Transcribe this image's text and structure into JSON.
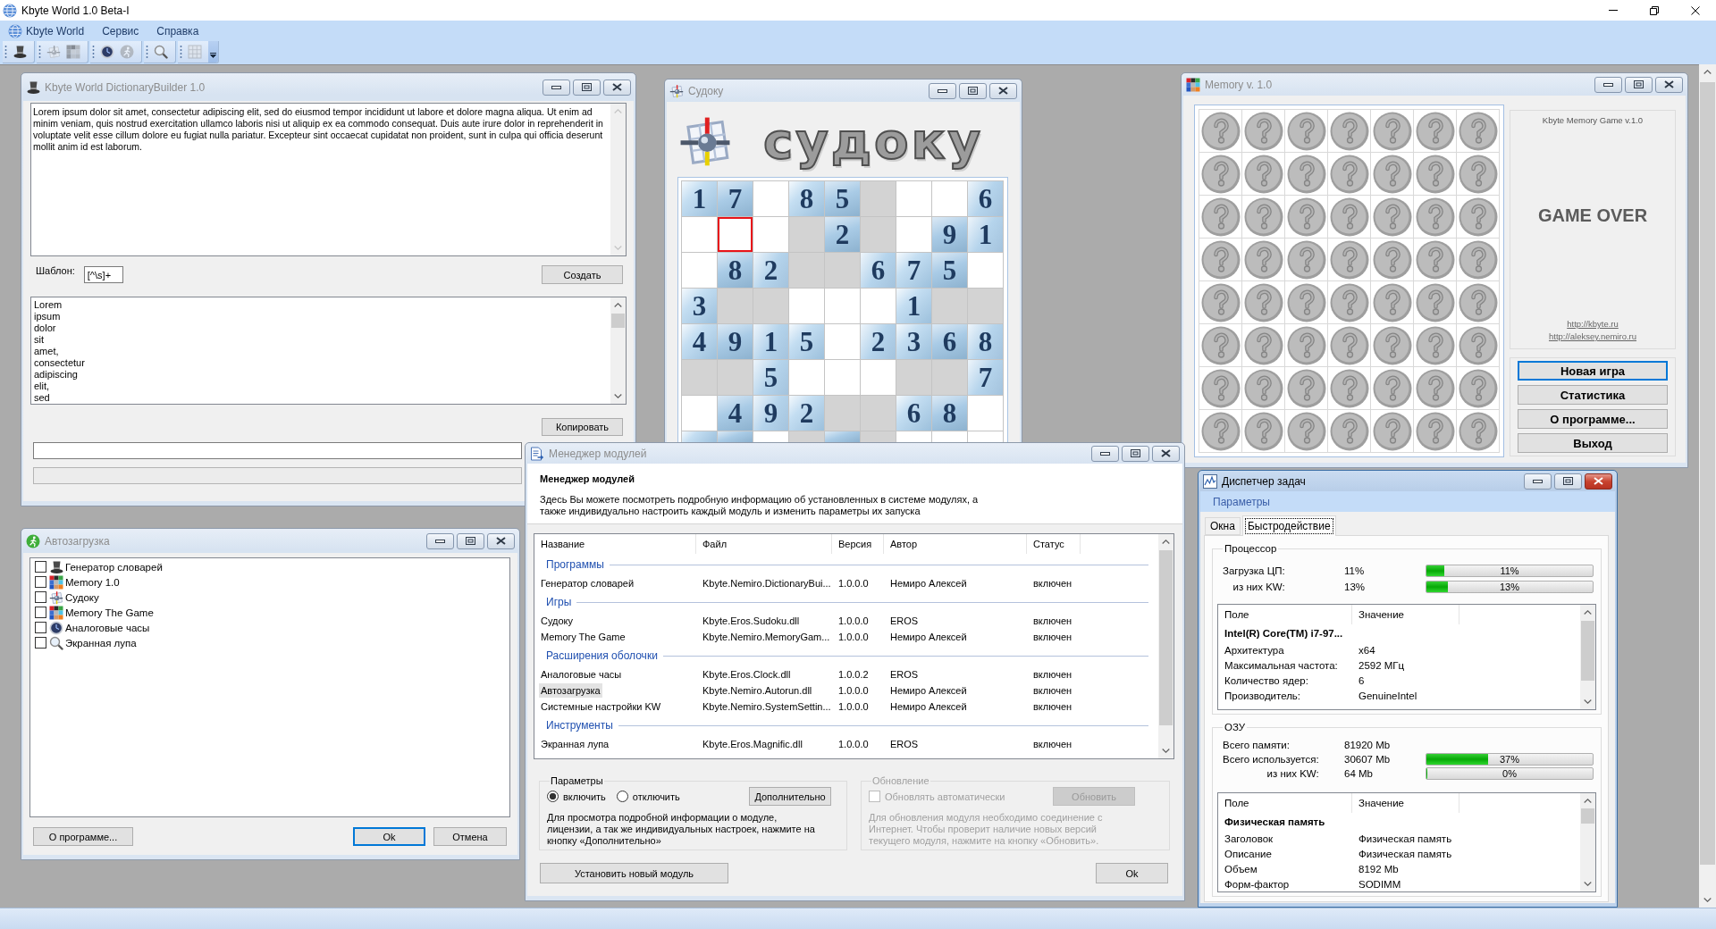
{
  "app": {
    "title": "Kbyte World 1.0 Beta-I",
    "menu": [
      {
        "label": "Kbyte World"
      },
      {
        "label": "Сервис"
      },
      {
        "label": "Справка"
      }
    ]
  },
  "toolbar": [
    {
      "disabled": false
    },
    {
      "disabled": true
    },
    {
      "disabled": true
    },
    {
      "disabled": false
    },
    {
      "disabled": true
    },
    {
      "disabled": false
    },
    {
      "disabled": true
    }
  ],
  "dictionary": {
    "title": "Kbyte World DictionaryBuilder 1.0",
    "active": false,
    "text": "Lorem ipsum dolor sit amet, consectetur adipiscing elit, sed do eiusmod tempor incididunt ut labore et dolore magna aliqua. Ut enim ad minim veniam, quis nostrud exercitation ullamco laboris nisi ut aliquip ex ea commodo consequat. Duis aute irure dolor in reprehenderit in voluptate velit esse cillum dolore eu fugiat nulla pariatur. Excepteur sint occaecat cupidatat non proident, sunt in culpa qui officia deserunt mollit anim id est laborum.",
    "pattern_label": "Шаблон:",
    "pattern_value": "[^\\s]+",
    "create_button": "Создать",
    "words": [
      {
        "label": "Lorem",
        "selected": false
      },
      {
        "label": "ipsum",
        "selected": false
      },
      {
        "label": "dolor",
        "selected": false
      },
      {
        "label": "sit",
        "selected": false
      },
      {
        "label": "amet,",
        "selected": false
      },
      {
        "label": "consectetur",
        "selected": false
      },
      {
        "label": "adipiscing",
        "selected": false
      },
      {
        "label": "elit,",
        "selected": false
      },
      {
        "label": "sed",
        "selected": false
      }
    ],
    "copy_button": "Копировать",
    "status_field": {
      "disabled": true
    }
  },
  "sudoku": {
    "title": "Судоку",
    "active": false,
    "logo_text": "судоку",
    "rows": [
      [
        {
          "filled": true,
          "digit": "1",
          "selected": false
        },
        {
          "filled": true,
          "digit": "7",
          "selected": false
        },
        {
          "filled": false,
          "selected": false
        },
        {
          "filled": true,
          "digit": "8",
          "selected": false
        },
        {
          "filled": true,
          "digit": "5",
          "selected": false
        },
        {
          "filled": false,
          "selected": false
        },
        {
          "filled": false,
          "selected": false
        },
        {
          "filled": false,
          "selected": false
        },
        {
          "filled": true,
          "digit": "6",
          "selected": false
        }
      ],
      [
        {
          "filled": false,
          "selected": false
        },
        {
          "filled": false,
          "selected": true
        },
        {
          "filled": false,
          "selected": false
        },
        {
          "filled": false,
          "selected": false
        },
        {
          "filled": true,
          "digit": "2",
          "selected": false
        },
        {
          "filled": false,
          "selected": false
        },
        {
          "filled": false,
          "selected": false
        },
        {
          "filled": true,
          "digit": "9",
          "selected": false
        },
        {
          "filled": true,
          "digit": "1",
          "selected": false
        }
      ],
      [
        {
          "filled": false,
          "selected": false
        },
        {
          "filled": true,
          "digit": "8",
          "selected": false
        },
        {
          "filled": true,
          "digit": "2",
          "selected": false
        },
        {
          "filled": false,
          "selected": false
        },
        {
          "filled": false,
          "selected": false
        },
        {
          "filled": true,
          "digit": "6",
          "selected": false
        },
        {
          "filled": true,
          "digit": "7",
          "selected": false
        },
        {
          "filled": true,
          "digit": "5",
          "selected": false
        },
        {
          "filled": false,
          "selected": false
        }
      ],
      [
        {
          "filled": true,
          "digit": "3",
          "selected": false
        },
        {
          "filled": false,
          "selected": false
        },
        {
          "filled": false,
          "selected": false
        },
        {
          "filled": false,
          "selected": false
        },
        {
          "filled": false,
          "selected": false
        },
        {
          "filled": false,
          "selected": false
        },
        {
          "filled": true,
          "digit": "1",
          "selected": false
        },
        {
          "filled": false,
          "selected": false
        },
        {
          "filled": false,
          "selected": false
        }
      ],
      [
        {
          "filled": true,
          "digit": "4",
          "selected": false
        },
        {
          "filled": true,
          "digit": "9",
          "selected": false
        },
        {
          "filled": true,
          "digit": "1",
          "selected": false
        },
        {
          "filled": true,
          "digit": "5",
          "selected": false
        },
        {
          "filled": false,
          "selected": false
        },
        {
          "filled": true,
          "digit": "2",
          "selected": false
        },
        {
          "filled": true,
          "digit": "3",
          "selected": false
        },
        {
          "filled": true,
          "digit": "6",
          "selected": false
        },
        {
          "filled": true,
          "digit": "8",
          "selected": false
        }
      ],
      [
        {
          "filled": false,
          "selected": false
        },
        {
          "filled": false,
          "selected": false
        },
        {
          "filled": true,
          "digit": "5",
          "selected": false
        },
        {
          "filled": false,
          "selected": false
        },
        {
          "filled": false,
          "selected": false
        },
        {
          "filled": false,
          "selected": false
        },
        {
          "filled": false,
          "selected": false
        },
        {
          "filled": false,
          "selected": false
        },
        {
          "filled": true,
          "digit": "7",
          "selected": false
        }
      ],
      [
        {
          "filled": false,
          "selected": false
        },
        {
          "filled": true,
          "digit": "4",
          "selected": false
        },
        {
          "filled": true,
          "digit": "9",
          "selected": false
        },
        {
          "filled": true,
          "digit": "2",
          "selected": false
        },
        {
          "filled": false,
          "selected": false
        },
        {
          "filled": false,
          "selected": false
        },
        {
          "filled": true,
          "digit": "6",
          "selected": false
        },
        {
          "filled": true,
          "digit": "8",
          "selected": false
        },
        {
          "filled": false,
          "selected": false
        }
      ],
      [
        {
          "filled": true,
          "selected": false
        },
        {
          "filled": true,
          "selected": false
        },
        {
          "filled": false,
          "selected": false
        },
        {
          "filled": false,
          "selected": false
        },
        {
          "filled": true,
          "selected": false
        },
        {
          "filled": false,
          "selected": false
        },
        {
          "filled": false,
          "selected": false
        },
        {
          "filled": false,
          "selected": false
        },
        {
          "filled": false,
          "selected": false
        }
      ]
    ]
  },
  "memory": {
    "title": "Memory v. 1.0",
    "active": false,
    "board": [
      [
        {
          "revealed": false
        },
        {
          "revealed": false
        },
        {
          "revealed": false
        },
        {
          "revealed": false
        },
        {
          "revealed": false
        },
        {
          "revealed": false
        },
        {
          "revealed": false
        }
      ],
      [
        {
          "revealed": false
        },
        {
          "revealed": false
        },
        {
          "revealed": false
        },
        {
          "revealed": false
        },
        {
          "revealed": false
        },
        {
          "revealed": false
        },
        {
          "revealed": false
        }
      ],
      [
        {
          "revealed": false
        },
        {
          "revealed": false
        },
        {
          "revealed": false
        },
        {
          "revealed": false
        },
        {
          "revealed": false
        },
        {
          "revealed": false
        },
        {
          "revealed": false
        }
      ],
      [
        {
          "revealed": false
        },
        {
          "revealed": false
        },
        {
          "revealed": false
        },
        {
          "revealed": false
        },
        {
          "revealed": false
        },
        {
          "revealed": false
        },
        {
          "revealed": false
        }
      ],
      [
        {
          "revealed": false
        },
        {
          "revealed": false
        },
        {
          "revealed": false
        },
        {
          "revealed": false
        },
        {
          "revealed": false
        },
        {
          "revealed": false
        },
        {
          "revealed": false
        }
      ],
      [
        {
          "revealed": false
        },
        {
          "revealed": false
        },
        {
          "revealed": false
        },
        {
          "revealed": false
        },
        {
          "revealed": false
        },
        {
          "revealed": false
        },
        {
          "revealed": false
        }
      ],
      [
        {
          "revealed": false
        },
        {
          "revealed": false
        },
        {
          "revealed": false
        },
        {
          "revealed": false
        },
        {
          "revealed": false
        },
        {
          "revealed": false
        },
        {
          "revealed": false
        }
      ],
      [
        {
          "revealed": false
        },
        {
          "revealed": false
        },
        {
          "revealed": false
        },
        {
          "revealed": false
        },
        {
          "revealed": false
        },
        {
          "revealed": false
        },
        {
          "revealed": false
        }
      ]
    ],
    "caption": "Kbyte Memory Game v.1.0",
    "status": "GAME OVER",
    "links": [
      "http://kbyte.ru",
      "http://aleksey.nemiro.ru"
    ],
    "buttons": [
      {
        "label": "Новая игра",
        "focused": true
      },
      {
        "label": "Статистика",
        "focused": false
      },
      {
        "label": "О программе...",
        "focused": false
      },
      {
        "label": "Выход",
        "focused": false
      }
    ]
  },
  "autorun": {
    "title": "Автозагрузка",
    "active": false,
    "items": [
      {
        "label": "Генератор словарей",
        "checked": false
      },
      {
        "label": "Memory 1.0",
        "checked": false
      },
      {
        "label": "Судоку",
        "checked": false
      },
      {
        "label": "Memory The Game",
        "checked": false
      },
      {
        "label": "Аналоговые часы",
        "checked": false
      },
      {
        "label": "Экранная лупа",
        "checked": false
      }
    ],
    "buttons": [
      {
        "label": "О программе...",
        "focused": false
      },
      {
        "label": "Ok",
        "focused": true
      },
      {
        "label": "Отмена",
        "focused": false
      }
    ]
  },
  "modules": {
    "title": "Менеджер модулей",
    "active": false,
    "heading": "Менеджер модулей",
    "description": "Здесь Вы можете посмотреть подробную информацию об установленных в системе модулях, а также индивидуально настроить каждый модуль и изменить параметры их запуска",
    "columns": [
      "Название",
      "Файл",
      "Версия",
      "Автор",
      "Статус"
    ],
    "groups": [
      {
        "name": "Программы",
        "rows": [
          {
            "cells": [
              "Генератор словарей",
              "Kbyte.Nemiro.DictionaryBui...",
              "1.0.0.0",
              "Немиро Алексей",
              "включен"
            ],
            "selected": false
          }
        ]
      },
      {
        "name": "Игры",
        "rows": [
          {
            "cells": [
              "Судоку",
              "Kbyte.Eros.Sudoku.dll",
              "1.0.0.0",
              "EROS",
              "включен"
            ],
            "selected": false
          },
          {
            "cells": [
              "Memory The Game",
              "Kbyte.Nemiro.MemoryGam...",
              "1.0.0.0",
              "Немиро Алексей",
              "включен"
            ],
            "selected": false
          }
        ]
      },
      {
        "name": "Расширения оболочки",
        "rows": [
          {
            "cells": [
              "Аналоговые часы",
              "Kbyte.Eros.Clock.dll",
              "1.0.0.2",
              "EROS",
              "включен"
            ],
            "selected": false
          },
          {
            "cells": [
              "Автозагрузка",
              "Kbyte.Nemiro.Autorun.dll",
              "1.0.0.0",
              "Немиро Алексей",
              "включен"
            ],
            "selected": true
          },
          {
            "cells": [
              "Системные настройки KW",
              "Kbyte.Nemiro.SystemSettin...",
              "1.0.0.0",
              "Немиро Алексей",
              "включен"
            ],
            "selected": false
          }
        ]
      },
      {
        "name": "Инструменты",
        "rows": [
          {
            "cells": [
              "Экранная лупа",
              "Kbyte.Eros.Magnific.dll",
              "1.0.0.0",
              "EROS",
              "включен"
            ],
            "selected": false
          }
        ]
      }
    ],
    "parameters": {
      "title": "Параметры",
      "options": [
        {
          "label": "включить",
          "selected": true
        },
        {
          "label": "отключить",
          "selected": false
        }
      ],
      "button": "Дополнительно",
      "note": "Для просмотра подробной информации о модуле, лицензии, а так же индивидуальных настроек, нажмите на кнопку «Дополнительно»"
    },
    "update": {
      "title": "Обновление",
      "disabled": true,
      "checkbox": {
        "label": "Обновлять автоматически",
        "checked": false
      },
      "button": "Обновить",
      "note": "Для обновления модуля необходимо соединение с Интернет. Чтобы проверит наличие новых версий текущего модуля, нажмите на кнопку «Обновить»."
    },
    "buttons": [
      {
        "label": "Установить новый модуль",
        "focused": false
      },
      {
        "label": "Ok",
        "focused": false
      }
    ]
  },
  "task_manager": {
    "title": "Диспетчер задач",
    "active": true,
    "menu": [
      {
        "label": "Параметры"
      }
    ],
    "tabs": [
      {
        "label": "Окна",
        "selected": false
      },
      {
        "label": "Быстродействие",
        "selected": true
      }
    ],
    "cpu": {
      "title": "Процессор",
      "stats": [
        {
          "kind": "main",
          "label": "Загрузка ЦП:",
          "value": "11%",
          "level": 0.11,
          "reading": "11%"
        },
        {
          "kind": "sub",
          "label": "из них KW:",
          "value": "13%",
          "level": 0.13,
          "reading": "13%"
        }
      ],
      "table": {
        "columns": [
          "Поле",
          "Значение"
        ],
        "heading": "Intel(R) Core(TM) i7-97...",
        "rows": [
          [
            "Архитектура",
            "x64"
          ],
          [
            "Максимальная частота:",
            "2592 МГц"
          ],
          [
            "Количество ядер:",
            "6"
          ],
          [
            "Производитель:",
            "GenuineIntel"
          ]
        ]
      }
    },
    "ram": {
      "title": "ОЗУ",
      "stats": [
        {
          "kind": "main",
          "label": "Всего памяти:",
          "value": "81920 Mb"
        },
        {
          "kind": "main",
          "label": "Всего используется:",
          "value": "30607 Mb",
          "level": 0.37,
          "reading": "37%"
        },
        {
          "kind": "sub",
          "label": "из них KW:",
          "value": "64 Mb",
          "level": 0,
          "reading": "0%"
        }
      ],
      "table": {
        "columns": [
          "Поле",
          "Значение"
        ],
        "heading": "Физическая память",
        "rows": [
          [
            "Заголовок",
            "Физическая память"
          ],
          [
            "Описание",
            "Физическая память"
          ],
          [
            "Объем",
            "8192 Mb"
          ],
          [
            "Форм-фактор",
            "SODIMM"
          ]
        ]
      }
    }
  }
}
